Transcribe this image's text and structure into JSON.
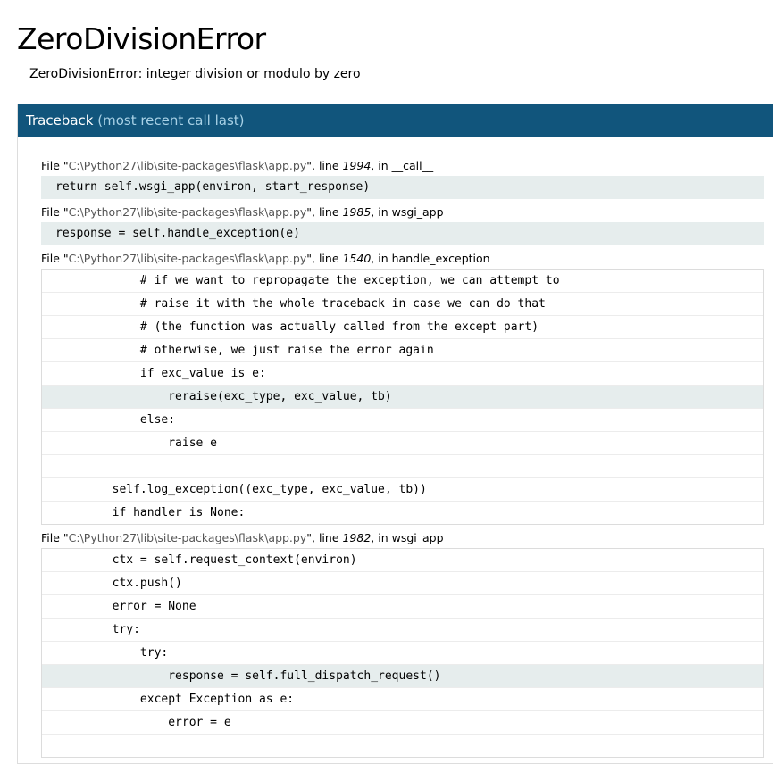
{
  "error": {
    "title": "ZeroDivisionError",
    "message": "ZeroDivisionError: integer division or modulo by zero"
  },
  "traceback": {
    "header_label": "Traceback",
    "header_muted": "(most recent call last)",
    "frames": [
      {
        "file_prefix": "File \"",
        "path": "C:\\Python27\\lib\\site-packages\\flask\\app.py",
        "mid": "\", line ",
        "lineno": "1994",
        "in_text": ", in ",
        "func": "__call__",
        "current": "return self.wsgi_app(environ, start_response)"
      },
      {
        "file_prefix": "File \"",
        "path": "C:\\Python27\\lib\\site-packages\\flask\\app.py",
        "mid": "\", line ",
        "lineno": "1985",
        "in_text": ", in ",
        "func": "wsgi_app",
        "current": "response = self.handle_exception(e)"
      },
      {
        "file_prefix": "File \"",
        "path": "C:\\Python27\\lib\\site-packages\\flask\\app.py",
        "mid": "\", line ",
        "lineno": "1540",
        "in_text": ", in ",
        "func": "handle_exception",
        "source": [
          "            # if we want to repropagate the exception, we can attempt to",
          "            # raise it with the whole traceback in case we can do that",
          "            # (the function was actually called from the except part)",
          "            # otherwise, we just raise the error again",
          "            if exc_value is e:",
          "                reraise(exc_type, exc_value, tb)",
          "            else:",
          "                raise e",
          "",
          "        self.log_exception((exc_type, exc_value, tb))",
          "        if handler is None:"
        ]
      },
      {
        "file_prefix": "File \"",
        "path": "C:\\Python27\\lib\\site-packages\\flask\\app.py",
        "mid": "\", line ",
        "lineno": "1982",
        "in_text": ", in ",
        "func": "wsgi_app",
        "source": [
          "        ctx = self.request_context(environ)",
          "        ctx.push()",
          "        error = None",
          "        try:",
          "            try:",
          "                response = self.full_dispatch_request()",
          "            except Exception as e:",
          "                error = e",
          ""
        ]
      }
    ]
  }
}
